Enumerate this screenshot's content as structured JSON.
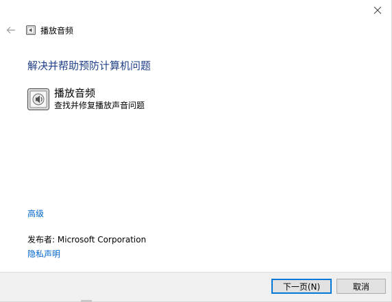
{
  "window": {
    "title": "播放音频",
    "close_icon": "close-icon",
    "back_icon": "back-arrow-icon"
  },
  "main": {
    "heading": "解决并帮助预防计算机问题",
    "item": {
      "title": "播放音频",
      "description": "查找并修复播放声音问题",
      "icon": "audio-troubleshooter-icon"
    },
    "advanced_link": "高级",
    "publisher_label": "发布者:",
    "publisher_value": "Microsoft Corporation",
    "privacy_link": "隐私声明"
  },
  "footer": {
    "next_label": "下一页(N)",
    "cancel_label": "取消"
  },
  "colors": {
    "heading": "#1e3f87",
    "link": "#0066cc",
    "footer_bg": "#f0f0f0",
    "focus_border": "#0078d7"
  }
}
